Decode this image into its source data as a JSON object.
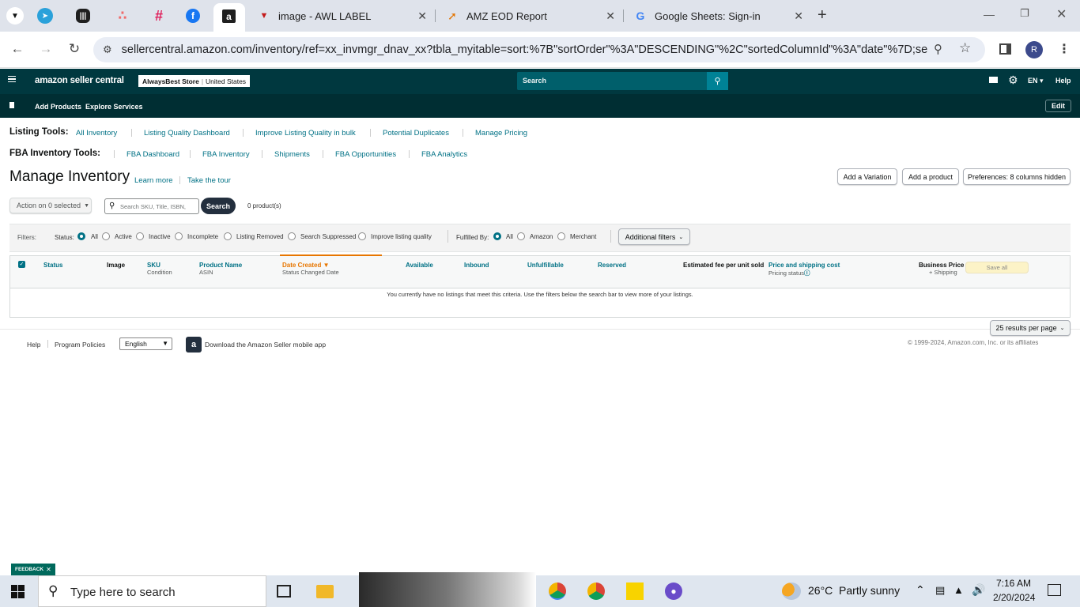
{
  "browser": {
    "tabs": [
      {
        "title": "image - AWL LABEL",
        "icon": "vercel-triangle-icon"
      },
      {
        "title": "AMZ EOD Report",
        "icon": "sheets-report-icon"
      },
      {
        "title": "Google Sheets: Sign-in",
        "icon": "google-icon"
      }
    ],
    "new_tab": "+",
    "url": "sellercentral.amazon.com/inventory/ref=xx_invmgr_dnav_xx?tbla_myitable=sort:%7B\"sortOrder\"%3A\"DESCENDING\"%2C\"sortedColumnId\"%3A\"date\"%7D;search:;p...",
    "profile_initial": "R"
  },
  "header": {
    "logo": "amazon seller central",
    "store": "AlwaysBest Store",
    "marketplace": "United States",
    "search_placeholder": "Search",
    "language": "EN",
    "help": "Help",
    "nav": [
      "Add Products",
      "Explore Services"
    ],
    "edit": "Edit"
  },
  "listing_tools": {
    "label": "Listing Tools:",
    "links": [
      "All Inventory",
      "Listing Quality Dashboard",
      "Improve Listing Quality in bulk",
      "Potential Duplicates",
      "Manage Pricing"
    ]
  },
  "fba_tools": {
    "label": "FBA Inventory Tools:",
    "links": [
      "FBA Dashboard",
      "FBA Inventory",
      "Shipments",
      "FBA Opportunities",
      "FBA Analytics"
    ]
  },
  "page": {
    "title": "Manage Inventory",
    "learn_more": "Learn more",
    "tour": "Take the tour",
    "add_variation": "Add a Variation",
    "add_product": "Add a product",
    "preferences": "Preferences: 8 columns hidden",
    "action": "Action on 0 selected",
    "search_placeholder": "Search SKU, Title, ISBN,",
    "search_btn": "Search",
    "count": "0 product(s)"
  },
  "filters": {
    "label": "Filters:",
    "status_label": "Status:",
    "status": [
      "All",
      "Active",
      "Inactive",
      "Incomplete",
      "Listing Removed",
      "Search Suppressed",
      "Improve listing quality"
    ],
    "fulfilled_label": "Fulfilled By:",
    "fulfilled": [
      "All",
      "Amazon",
      "Merchant"
    ],
    "additional": "Additional filters"
  },
  "table": {
    "cols": {
      "status": "Status",
      "image": "Image",
      "sku": "SKU",
      "condition": "Condition",
      "product_name": "Product Name",
      "asin": "ASIN",
      "date_created": "Date Created",
      "status_changed": "Status Changed Date",
      "available": "Available",
      "inbound": "Inbound",
      "unfulfillable": "Unfulfillable",
      "reserved": "Reserved",
      "fee": "Estimated fee per unit sold",
      "price": "Price and shipping cost",
      "pricing_status": "Pricing status",
      "business_price": "Business Price",
      "shipping": "+ Shipping",
      "save_all": "Save all"
    },
    "empty": "You currently have no listings that meet this criteria. Use the filters below the search bar to view more of your listings.",
    "per_page": "25 results per page"
  },
  "footer": {
    "help": "Help",
    "policies": "Program Policies",
    "language": "English",
    "app": "Download the Amazon Seller mobile app",
    "copyright": "© 1999-2024, Amazon.com, Inc. or its affiliates",
    "feedback": "FEEDBACK"
  },
  "taskbar": {
    "search_placeholder": "Type here to search",
    "weather": "26°C  Partly sunny",
    "time": "7:16 AM",
    "date": "2/20/2024"
  },
  "colors": {
    "header": "#00383f",
    "subnav": "#002e33",
    "link": "#007185",
    "accent": "#e77600"
  }
}
